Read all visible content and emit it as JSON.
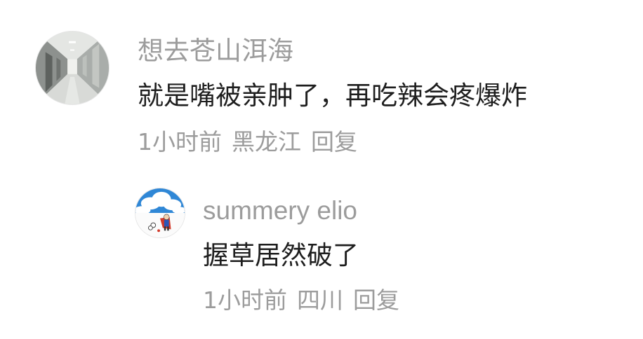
{
  "comments": [
    {
      "username": "想去苍山洱海",
      "content": "就是嘴被亲肿了，再吃辣会疼爆炸",
      "time": "1小时前",
      "region": "黑龙江",
      "reply_label": "回复",
      "avatar_icon": "hallway-photo-avatar"
    }
  ],
  "replies": [
    {
      "username": "summery elio",
      "content": "握草居然破了",
      "time": "1小时前",
      "region": "四川",
      "reply_label": "回复",
      "avatar_icon": "sky-cartoon-avatar"
    }
  ]
}
